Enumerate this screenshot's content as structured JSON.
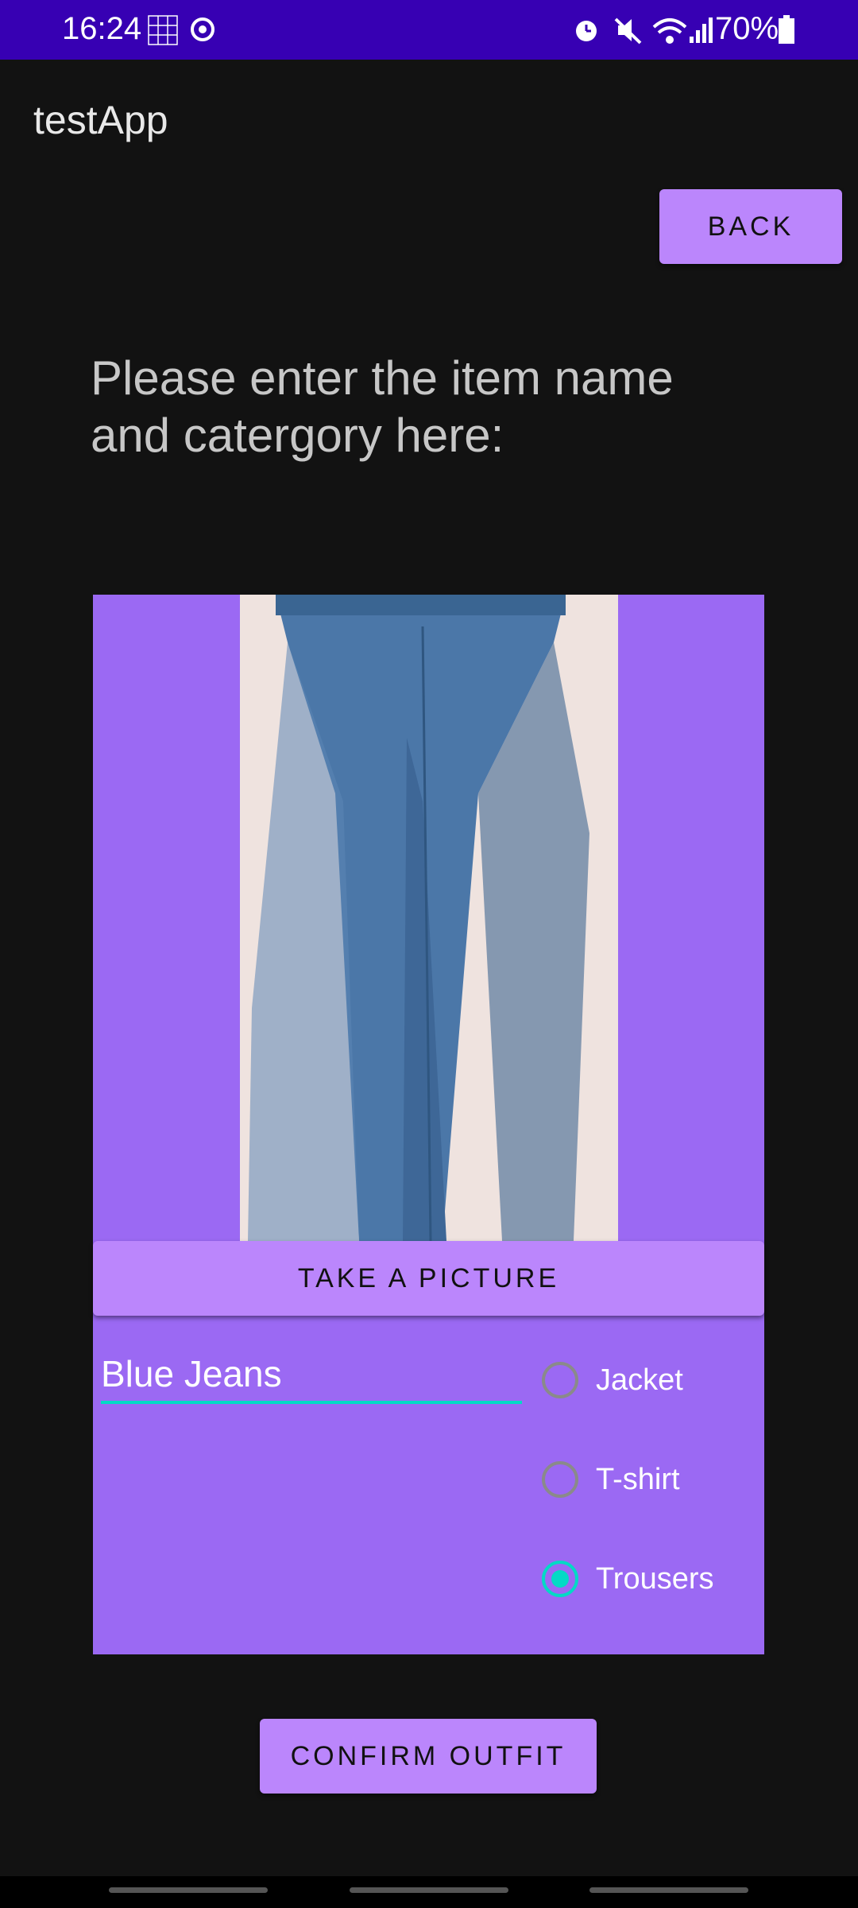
{
  "status_bar": {
    "time": "16:24",
    "battery_text": "70%",
    "icons": [
      "sudoku-grid-icon",
      "sync-icon",
      "alarm-icon",
      "mute-icon",
      "wifi-icon",
      "signal-icon",
      "battery-icon"
    ]
  },
  "app": {
    "title": "testApp"
  },
  "back_button": {
    "label": "BACK"
  },
  "prompt": {
    "text": "Please enter the item name and catergory here:"
  },
  "photo": {
    "subject": "blue jeans on bed"
  },
  "take_picture_button": {
    "label": "TAKE A PICTURE"
  },
  "item_name_input": {
    "value": "Blue Jeans"
  },
  "category_options": [
    {
      "label": "Jacket",
      "checked": false
    },
    {
      "label": "T-shirt",
      "checked": false
    },
    {
      "label": "Trousers",
      "checked": true
    }
  ],
  "confirm_button": {
    "label": "CONFIRM OUTFIT"
  },
  "colors": {
    "status_bar": "#3700b3",
    "background": "#121212",
    "card": "#9b69f3",
    "button": "#bb86fc",
    "accent": "#03dac5"
  }
}
